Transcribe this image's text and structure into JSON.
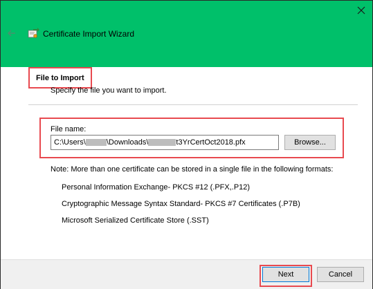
{
  "window": {
    "title": "Certificate Import Wizard"
  },
  "page": {
    "heading": "File to Import",
    "subheading": "Specify the file you want to import."
  },
  "file": {
    "label": "File name:",
    "value_prefix": "C:\\Users\\",
    "value_middle": "\\Downloads\\",
    "value_suffix": "t3YrCertOct2018.pfx",
    "browse_label": "Browse..."
  },
  "note": {
    "text": "Note:  More than one certificate can be stored in a single file in the following formats:",
    "formats": [
      "Personal Information Exchange- PKCS #12 (.PFX,.P12)",
      "Cryptographic Message Syntax Standard- PKCS #7 Certificates (.P7B)",
      "Microsoft Serialized Certificate Store (.SST)"
    ]
  },
  "footer": {
    "next_label": "Next",
    "cancel_label": "Cancel"
  },
  "colors": {
    "titlebar": "#00c06a",
    "highlight": "#e8494f"
  }
}
